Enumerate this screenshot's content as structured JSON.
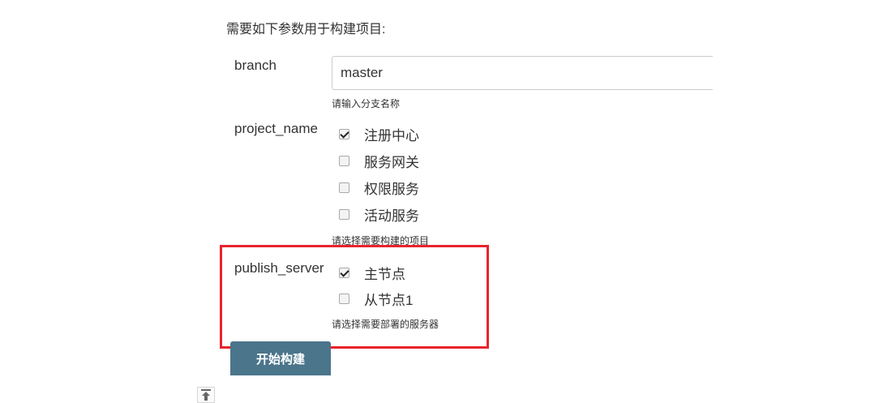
{
  "heading": "需要如下参数用于构建项目:",
  "branch": {
    "label": "branch",
    "value": "master",
    "description": "请输入分支名称"
  },
  "project_name": {
    "label": "project_name",
    "options": [
      {
        "label": "注册中心",
        "checked": true
      },
      {
        "label": "服务网关",
        "checked": false
      },
      {
        "label": "权限服务",
        "checked": false
      },
      {
        "label": "活动服务",
        "checked": false
      }
    ],
    "description": "请选择需要构建的项目"
  },
  "publish_server": {
    "label": "publish_server",
    "options": [
      {
        "label": "主节点",
        "checked": true
      },
      {
        "label": "从节点1",
        "checked": false
      }
    ],
    "description": "请选择需要部署的服务器"
  },
  "build_button": "开始构建",
  "back_to_top_icon": "arrow-up-to-line-icon",
  "colors": {
    "highlight": "#e8242d",
    "button": "#4b758b"
  }
}
